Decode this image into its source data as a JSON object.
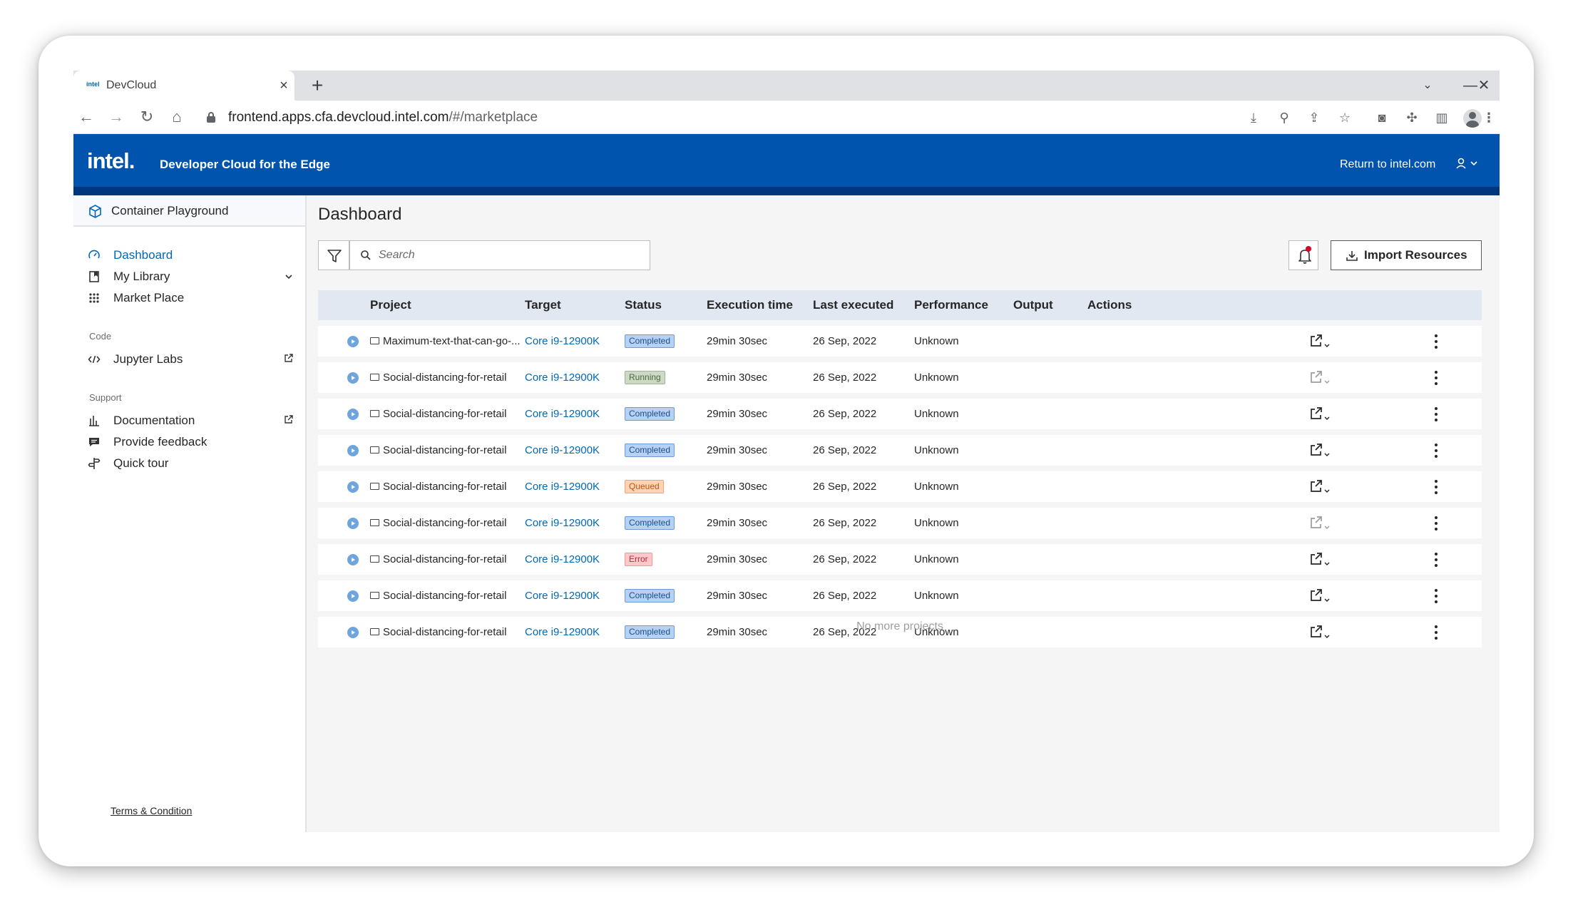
{
  "browser": {
    "tab_title": "DevCloud",
    "tab_close": "×",
    "new_tab": "+",
    "url_host": "frontend.apps.cfa.devcloud.intel.com",
    "url_path": "/#/marketplace"
  },
  "header": {
    "logo": "intel.",
    "app_title": "Developer Cloud for the Edge",
    "return_link": "Return to intel.com",
    "brand_color": "#0054ae"
  },
  "sidebar": {
    "header_label": "Container Playground",
    "items": [
      {
        "label": "Dashboard",
        "icon": "gauge-icon"
      },
      {
        "label": "My Library",
        "icon": "library-icon"
      },
      {
        "label": "Market Place",
        "icon": "grid-icon"
      }
    ],
    "code_section": "Code",
    "code_items": [
      {
        "label": "Jupyter Labs",
        "icon": "code-icon"
      }
    ],
    "support_section": "Support",
    "support_items": [
      {
        "label": "Documentation",
        "icon": "chart-icon"
      },
      {
        "label": "Provide feedback",
        "icon": "feedback-icon"
      },
      {
        "label": "Quick tour",
        "icon": "tour-icon"
      }
    ],
    "terms": "Terms & Condition"
  },
  "main": {
    "title": "Dashboard",
    "search_placeholder": "Search",
    "import_label": "Import Resources",
    "no_more": "No more projects"
  },
  "table": {
    "columns": [
      "Project",
      "Target",
      "Status",
      "Execution time",
      "Last executed",
      "Performance",
      "Output",
      "Actions"
    ],
    "rows": [
      {
        "project": "Maximum-text-that-can-go-...",
        "target": "Core i9-12900K",
        "status": "Completed",
        "status_kind": "completed",
        "exec_time": "29min 30sec",
        "last_executed": "26 Sep, 2022",
        "performance": "Unknown",
        "output_enabled": true
      },
      {
        "project": "Social-distancing-for-retail",
        "target": "Core i9-12900K",
        "status": "Running",
        "status_kind": "running",
        "exec_time": "29min 30sec",
        "last_executed": "26 Sep, 2022",
        "performance": "Unknown",
        "output_enabled": false
      },
      {
        "project": "Social-distancing-for-retail",
        "target": "Core i9-12900K",
        "status": "Completed",
        "status_kind": "completed",
        "exec_time": "29min 30sec",
        "last_executed": "26 Sep, 2022",
        "performance": "Unknown",
        "output_enabled": true
      },
      {
        "project": "Social-distancing-for-retail",
        "target": "Core i9-12900K",
        "status": "Completed",
        "status_kind": "completed",
        "exec_time": "29min 30sec",
        "last_executed": "26 Sep, 2022",
        "performance": "Unknown",
        "output_enabled": true
      },
      {
        "project": "Social-distancing-for-retail",
        "target": "Core i9-12900K",
        "status": "Queued",
        "status_kind": "queued",
        "exec_time": "29min 30sec",
        "last_executed": "26 Sep, 2022",
        "performance": "Unknown",
        "output_enabled": true
      },
      {
        "project": "Social-distancing-for-retail",
        "target": "Core i9-12900K",
        "status": "Completed",
        "status_kind": "completed",
        "exec_time": "29min 30sec",
        "last_executed": "26 Sep, 2022",
        "performance": "Unknown",
        "output_enabled": false
      },
      {
        "project": "Social-distancing-for-retail",
        "target": "Core i9-12900K",
        "status": "Error",
        "status_kind": "error",
        "exec_time": "29min 30sec",
        "last_executed": "26 Sep, 2022",
        "performance": "Unknown",
        "output_enabled": true
      },
      {
        "project": "Social-distancing-for-retail",
        "target": "Core i9-12900K",
        "status": "Completed",
        "status_kind": "completed",
        "exec_time": "29min 30sec",
        "last_executed": "26 Sep, 2022",
        "performance": "Unknown",
        "output_enabled": true
      },
      {
        "project": "Social-distancing-for-retail",
        "target": "Core i9-12900K",
        "status": "Completed",
        "status_kind": "completed",
        "exec_time": "29min 30sec",
        "last_executed": "26 Sep, 2022",
        "performance": "Unknown",
        "output_enabled": true
      }
    ]
  }
}
